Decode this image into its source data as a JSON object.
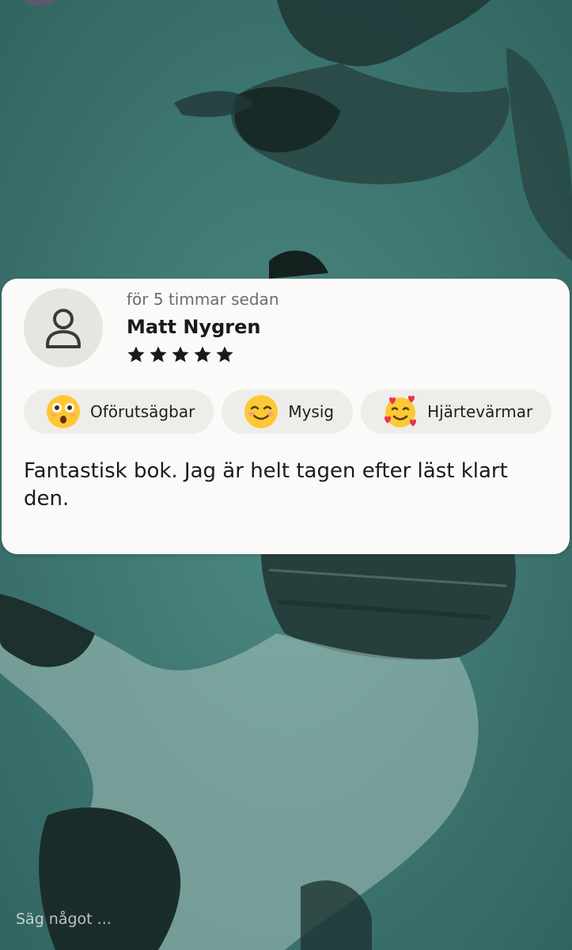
{
  "review": {
    "timestamp": "för 5 timmar sedan",
    "reviewer_name": "Matt Nygren",
    "rating": 5,
    "rating_max": 5,
    "tags": [
      {
        "label": "Oförutsägbar",
        "emoji": "astonished-face-icon"
      },
      {
        "label": "Mysig",
        "emoji": "smiling-face-icon"
      },
      {
        "label": "Hjärtevärmar",
        "emoji": "smiling-face-with-hearts-icon"
      }
    ],
    "text": "Fantastisk bok. Jag är helt tagen efter läst klart den."
  },
  "comment": {
    "placeholder": "Säg något ..."
  },
  "colors": {
    "background_teal": "#3f7a75",
    "card_background": "#fbfaf8",
    "chip_background": "#efedea",
    "star": "#1a1a1a"
  }
}
